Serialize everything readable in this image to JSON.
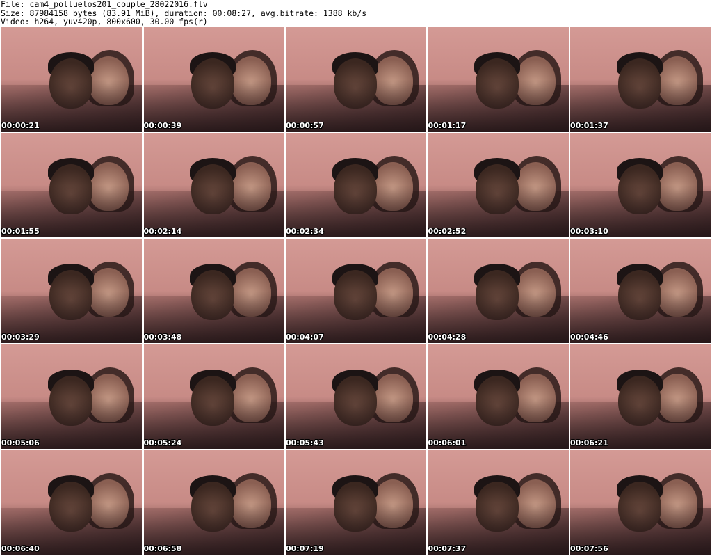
{
  "header": {
    "line1": "File: cam4_polluelos201_couple_28022016.flv",
    "line2": "Size: 87984158 bytes (83.91 MiB), duration: 00:08:27, avg.bitrate: 1388 kb/s",
    "line3": "Video: h264, yuv420p, 800x600, 30.00 fps(r)"
  },
  "thumbnails": [
    {
      "time": "00:00:21"
    },
    {
      "time": "00:00:39"
    },
    {
      "time": "00:00:57"
    },
    {
      "time": "00:01:17"
    },
    {
      "time": "00:01:37"
    },
    {
      "time": "00:01:55"
    },
    {
      "time": "00:02:14"
    },
    {
      "time": "00:02:34"
    },
    {
      "time": "00:02:52"
    },
    {
      "time": "00:03:10"
    },
    {
      "time": "00:03:29"
    },
    {
      "time": "00:03:48"
    },
    {
      "time": "00:04:07"
    },
    {
      "time": "00:04:28"
    },
    {
      "time": "00:04:46"
    },
    {
      "time": "00:05:06"
    },
    {
      "time": "00:05:24"
    },
    {
      "time": "00:05:43"
    },
    {
      "time": "00:06:01"
    },
    {
      "time": "00:06:21"
    },
    {
      "time": "00:06:40"
    },
    {
      "time": "00:06:58"
    },
    {
      "time": "00:07:19"
    },
    {
      "time": "00:07:37"
    },
    {
      "time": "00:07:56"
    }
  ]
}
